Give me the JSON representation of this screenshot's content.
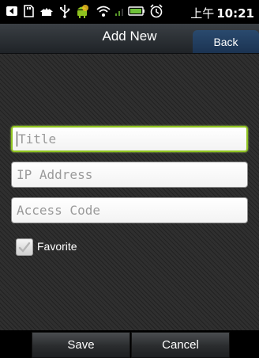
{
  "status_bar": {
    "icons": [
      "back-arrow-icon",
      "sd-card-icon",
      "usb-debug-icon",
      "usb-icon",
      "android-icon",
      "wifi-icon",
      "signal-icon",
      "battery-icon",
      "alarm-icon"
    ],
    "time_prefix": "上午",
    "time": "10:21"
  },
  "titlebar": {
    "title": "Add New",
    "back_label": "Back"
  },
  "form": {
    "title_placeholder": "Title",
    "ip_placeholder": "IP Address",
    "code_placeholder": "Access Code",
    "favorite_label": "Favorite"
  },
  "buttons": {
    "save": "Save",
    "cancel": "Cancel"
  },
  "colors": {
    "focus": "#8fc31f",
    "back_button": "#1b3352"
  }
}
